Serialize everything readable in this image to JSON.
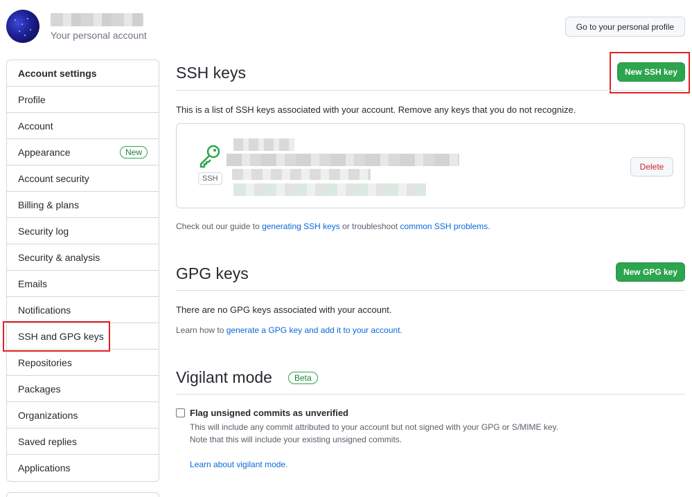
{
  "header": {
    "subtitle": "Your personal account",
    "profile_button": "Go to your personal profile"
  },
  "sidebar": {
    "heading": "Account settings",
    "items": [
      {
        "label": "Profile"
      },
      {
        "label": "Account"
      },
      {
        "label": "Appearance",
        "badge": "New"
      },
      {
        "label": "Account security"
      },
      {
        "label": "Billing & plans"
      },
      {
        "label": "Security log"
      },
      {
        "label": "Security & analysis"
      },
      {
        "label": "Emails"
      },
      {
        "label": "Notifications"
      },
      {
        "label": "SSH and GPG keys"
      },
      {
        "label": "Repositories"
      },
      {
        "label": "Packages"
      },
      {
        "label": "Organizations"
      },
      {
        "label": "Saved replies"
      },
      {
        "label": "Applications"
      }
    ]
  },
  "ssh": {
    "title": "SSH keys",
    "new_button": "New SSH key",
    "description": "This is a list of SSH keys associated with your account. Remove any keys that you do not recognize.",
    "key_type_label": "SSH",
    "delete_button": "Delete",
    "guide_prefix": "Check out our guide to ",
    "guide_link1": "generating SSH keys",
    "guide_middle": " or troubleshoot ",
    "guide_link2": "common SSH problems",
    "guide_suffix": "."
  },
  "gpg": {
    "title": "GPG keys",
    "new_button": "New GPG key",
    "empty_text": "There are no GPG keys associated with your account.",
    "learn_prefix": "Learn how to ",
    "learn_link": "generate a GPG key and add it to your account",
    "learn_suffix": "."
  },
  "vigilant": {
    "title": "Vigilant mode",
    "badge": "Beta",
    "checkbox_label": "Flag unsigned commits as unverified",
    "checkbox_checked": false,
    "note1": "This will include any commit attributed to your account but not signed with your GPG or S/MIME key.",
    "note2": "Note that this will include your existing unsigned commits.",
    "learn_link": "Learn about vigilant mode."
  },
  "colors": {
    "primary_green": "#2da44e",
    "link_blue": "#0969da",
    "danger_red": "#cf222e",
    "highlight_red": "#e02020"
  }
}
